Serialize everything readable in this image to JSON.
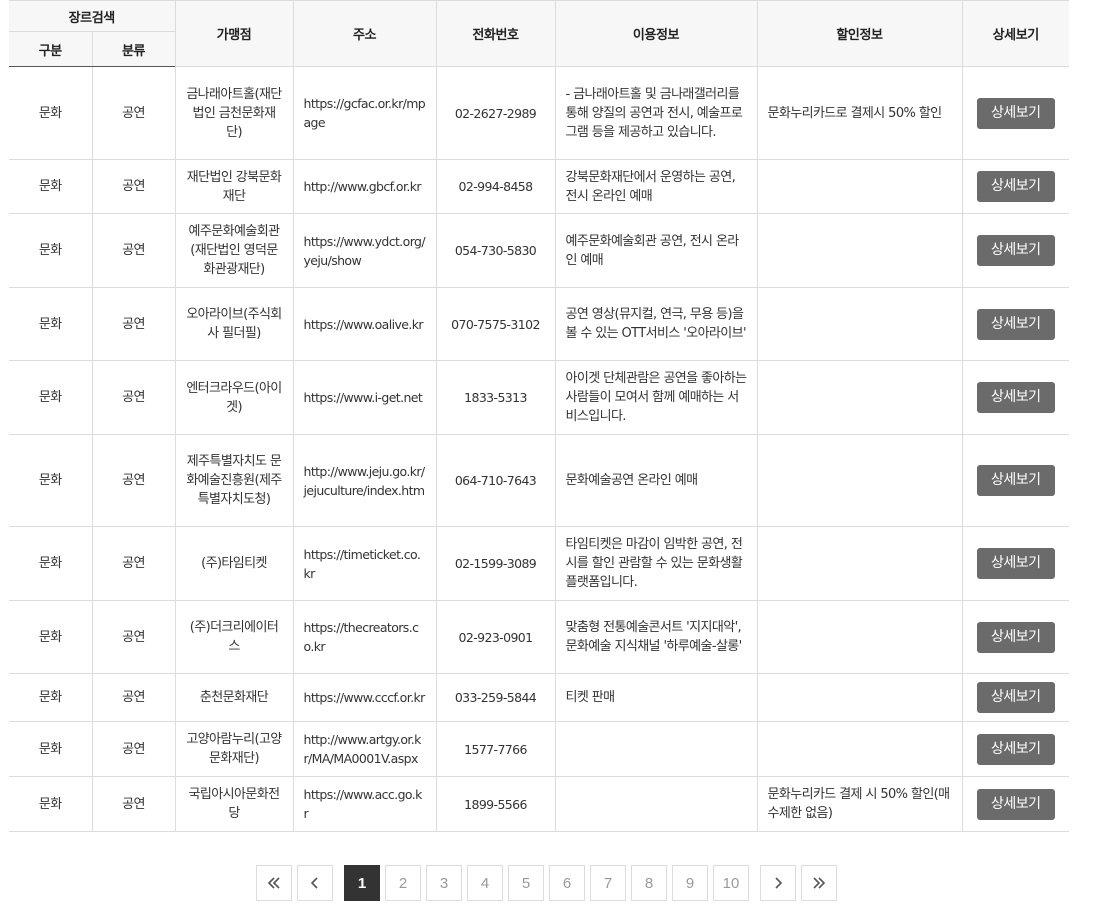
{
  "table": {
    "headers": {
      "genre_search": "장르검색",
      "category": "구분",
      "classification": "분류",
      "store": "가맹점",
      "address": "주소",
      "phone": "전화번호",
      "usage_info": "이용정보",
      "discount_info": "할인정보",
      "detail": "상세보기"
    },
    "rows": [
      {
        "category": "문화",
        "classification": "공연",
        "name": "금나래아트홀(재단법인 금천문화재단)",
        "address": "https://gcfac.or.kr/mpage",
        "phone": "02-2627-2989",
        "info": "- 금나래아트홀 및 금나래갤러리를 통해 양질의 공연과 전시, 예술프로그램 등을 제공하고 있습니다.",
        "discount": "문화누리카드로 결제시 50% 할인",
        "button": "상세보기"
      },
      {
        "category": "문화",
        "classification": "공연",
        "name": "재단법인 강북문화재단",
        "address": "http://www.gbcf.or.kr",
        "phone": "02-994-8458",
        "info": "강북문화재단에서 운영하는 공연, 전시 온라인 예매",
        "discount": "",
        "button": "상세보기"
      },
      {
        "category": "문화",
        "classification": "공연",
        "name": "예주문화예술회관(재단법인 영덕문화관광재단)",
        "address": "https://www.ydct.org/yeju/show",
        "phone": "054-730-5830",
        "info": "예주문화예술회관 공연, 전시 온라인 예매",
        "discount": "",
        "button": "상세보기"
      },
      {
        "category": "문화",
        "classification": "공연",
        "name": "오아라이브(주식회사 필더필)",
        "address": "https://www.oalive.kr",
        "phone": "070-7575-3102",
        "info": "공연 영상(뮤지컬, 연극, 무용 등)을 볼 수 있는 OTT서비스 '오아라이브'",
        "discount": "",
        "button": "상세보기"
      },
      {
        "category": "문화",
        "classification": "공연",
        "name": "엔터크라우드(아이겟)",
        "address": "https://www.i-get.net",
        "phone": "1833-5313",
        "info": "아이겟 단체관람은 공연을 좋아하는 사람들이 모여서 함께 예매하는 서비스입니다.",
        "discount": "",
        "button": "상세보기"
      },
      {
        "category": "문화",
        "classification": "공연",
        "name": "제주특별자치도 문화예술진흥원(제주특별자치도청)",
        "address": "http://www.jeju.go.kr/jejuculture/index.htm",
        "phone": "064-710-7643",
        "info": "문화예술공연 온라인 예매",
        "discount": "",
        "button": "상세보기"
      },
      {
        "category": "문화",
        "classification": "공연",
        "name": "(주)타임티켓",
        "address": "https://timeticket.co.kr",
        "phone": "02-1599-3089",
        "info": "타임티켓은 마감이 임박한 공연, 전시를 할인 관람할 수 있는 문화생활 플랫폼입니다.",
        "discount": "",
        "button": "상세보기"
      },
      {
        "category": "문화",
        "classification": "공연",
        "name": "(주)더크리에이터스",
        "address": "https://thecreators.co.kr",
        "phone": "02-923-0901",
        "info": "맞춤형 전통예술콘서트 '지지대악', 문화예술 지식채널 '하루예술-살롱'",
        "discount": "",
        "button": "상세보기"
      },
      {
        "category": "문화",
        "classification": "공연",
        "name": "춘천문화재단",
        "address": "https://www.cccf.or.kr",
        "phone": "033-259-5844",
        "info": "티켓 판매",
        "discount": "",
        "button": "상세보기"
      },
      {
        "category": "문화",
        "classification": "공연",
        "name": "고양아람누리(고양문화재단)",
        "address": "http://www.artgy.or.kr/MA/MA0001V.aspx",
        "phone": "1577-7766",
        "info": "",
        "discount": "",
        "button": "상세보기"
      },
      {
        "category": "문화",
        "classification": "공연",
        "name": "국립아시아문화전당",
        "address": "https://www.acc.go.kr",
        "phone": "1899-5566",
        "info": "",
        "discount": "문화누리카드 결제 시 50% 할인(매수제한 없음)",
        "button": "상세보기"
      }
    ]
  },
  "pagination": {
    "first_icon": "double-chevron-left-icon",
    "prev_icon": "chevron-left-icon",
    "next_icon": "chevron-right-icon",
    "last_icon": "double-chevron-right-icon",
    "pages": [
      "1",
      "2",
      "3",
      "4",
      "5",
      "6",
      "7",
      "8",
      "9",
      "10"
    ],
    "current": "1"
  }
}
